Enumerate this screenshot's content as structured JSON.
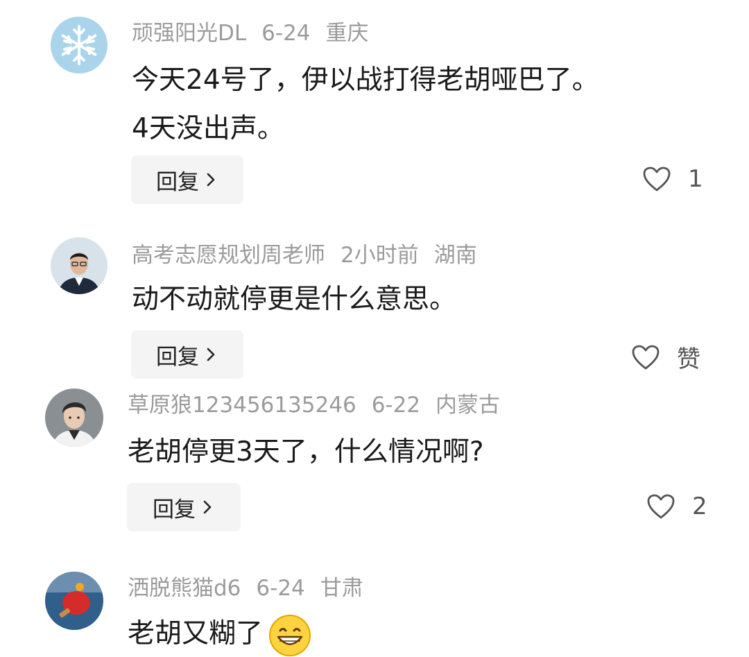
{
  "comments": [
    {
      "username": "顽强阳光DL",
      "time": "6-24",
      "location": "重庆",
      "text_line1": "今天24号了，伊以战打得老胡哑巴了。",
      "text_line2": "4天没出声。",
      "reply_label": "回复",
      "like_count": "1",
      "avatar_icon": "snowflake-icon"
    },
    {
      "username": "高考志愿规划周老师",
      "time": "2小时前",
      "location": "湖南",
      "text_line1": "动不动就停更是什么意思。",
      "reply_label": "回复",
      "like_count": "赞",
      "avatar_icon": "man-portrait-icon"
    },
    {
      "username": "草原狼123456135246",
      "time": "6-22",
      "location": "内蒙古",
      "text_line1": "老胡停更3天了，什么情况啊?",
      "reply_label": "回复",
      "like_count": "2",
      "avatar_icon": "cartoon-man-icon"
    },
    {
      "username": "洒脱熊猫d6",
      "time": "6-24",
      "location": "甘肃",
      "text_line1": "老胡又糊了",
      "avatar_icon": "ping-pong-icon",
      "emoji_icon": "grinning-face-icon"
    }
  ],
  "colors": {
    "meta_text": "#9b9b9b",
    "body_text": "#1a1a1a",
    "reply_bg": "#f4f4f4"
  }
}
